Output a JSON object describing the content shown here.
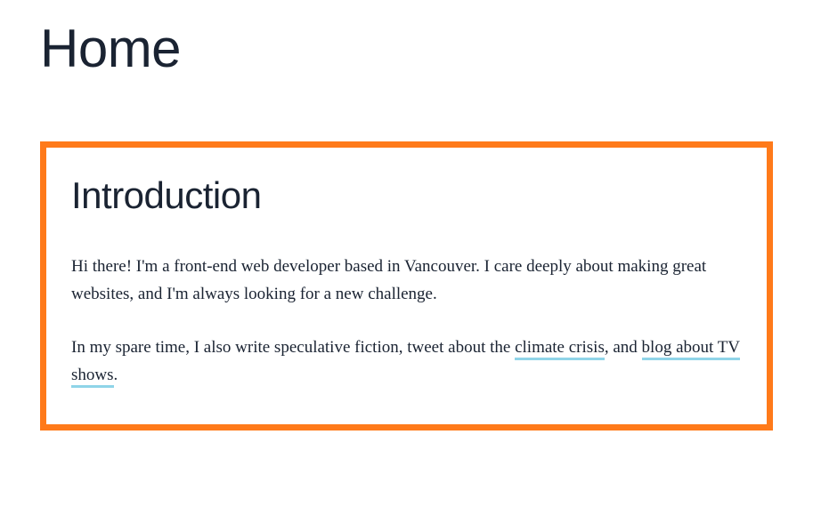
{
  "page": {
    "title": "Home"
  },
  "intro": {
    "heading": "Introduction",
    "paragraph1": "Hi there! I'm a front-end web developer based in Vancouver. I care deeply about making great websites, and I'm always looking for a new challenge.",
    "paragraph2_prefix": "In my spare time, I also write speculative fiction, tweet about the ",
    "link1": "climate crisis",
    "paragraph2_mid": ", and ",
    "link2": "blog about TV shows",
    "paragraph2_suffix": "."
  }
}
